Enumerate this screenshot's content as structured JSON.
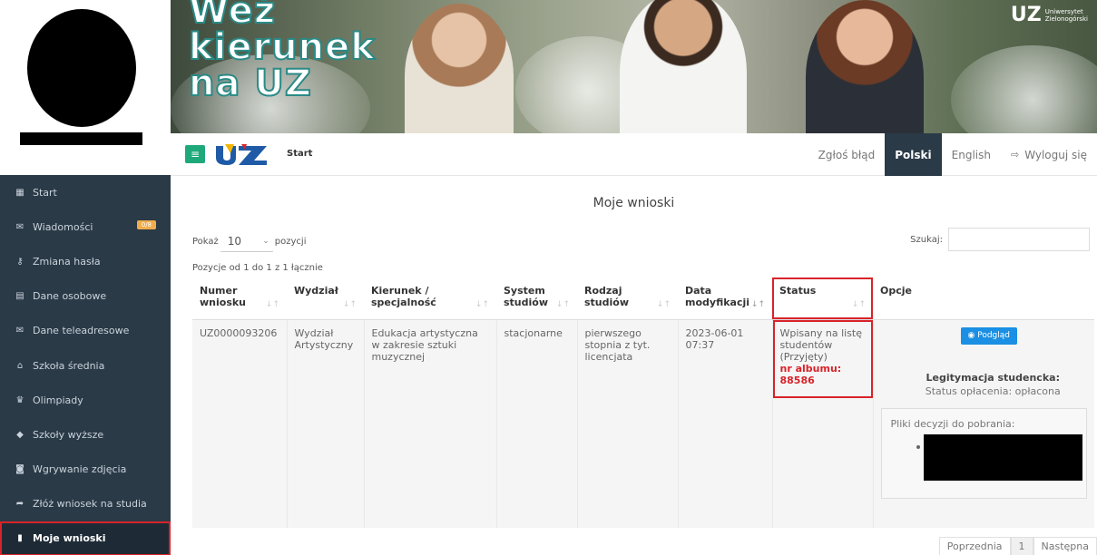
{
  "banner": {
    "title_line1": "Weź",
    "title_line2": "kierunek",
    "title_line3": "na UZ",
    "logo_big": "UZ",
    "logo_small_line1": "Uniwersytet",
    "logo_small_line2": "Zielonogórski"
  },
  "topbar": {
    "breadcrumb": "Start",
    "report_bug": "Zgłoś błąd",
    "lang_pl": "Polski",
    "lang_en": "English",
    "logout": "Wyloguj się"
  },
  "sidebar": {
    "items": [
      {
        "label": "Start",
        "icon": "dashboard-icon"
      },
      {
        "label": "Wiadomości",
        "icon": "envelope-icon",
        "badge": "0/8"
      },
      {
        "label": "Zmiana hasła",
        "icon": "key-icon"
      },
      {
        "label": "Dane osobowe",
        "icon": "id-card-icon"
      },
      {
        "label": "Dane teleadresowe",
        "icon": "envelope-icon"
      },
      {
        "label": "Szkoła średnia",
        "icon": "school-icon"
      },
      {
        "label": "Olimpiady",
        "icon": "trophy-icon"
      },
      {
        "label": "Szkoły wyższe",
        "icon": "graduation-cap-icon"
      },
      {
        "label": "Wgrywanie zdjęcia",
        "icon": "camera-icon"
      },
      {
        "label": "Złóż wniosek na studia",
        "icon": "share-icon"
      },
      {
        "label": "Moje wnioski",
        "icon": "file-icon",
        "active": true
      }
    ]
  },
  "main": {
    "title": "Moje wnioski",
    "show_label": "Pokaż",
    "show_value": "10",
    "show_suffix": "pozycji",
    "search_label": "Szukaj:",
    "search_value": "",
    "info": "Pozycje od 1 do 1 z 1 łącznie",
    "columns": [
      {
        "line1": "Numer",
        "line2": "wniosku"
      },
      {
        "line1": "Wydział",
        "line2": ""
      },
      {
        "line1": "Kierunek /",
        "line2": "specjalność"
      },
      {
        "line1": "System",
        "line2": "studiów"
      },
      {
        "line1": "Rodzaj",
        "line2": "studiów"
      },
      {
        "line1": "Data",
        "line2": "modyfikacji"
      },
      {
        "line1": "Status",
        "line2": ""
      },
      {
        "line1": "Opcje",
        "line2": ""
      }
    ],
    "row": {
      "numer": "UZ0000093206",
      "wydzial": "Wydział Artystyczny",
      "kierunek": "Edukacja artystyczna w zakresie sztuki muzycznej",
      "system": "stacjonarne",
      "rodzaj": "pierwszego stopnia z tyt. licencjata",
      "data": "2023-06-01 07:37",
      "status": "Wpisany na listę studentów (Przyjęty)",
      "album": "nr albumu: 88586",
      "podglad": "Podgląd",
      "leg_title": "Legitymacja studencka:",
      "leg_status": "Status opłacenia: opłacona",
      "files_label": "Pliki decyzji do pobrania:"
    },
    "pagination": {
      "prev": "Poprzednia",
      "page": "1",
      "next": "Następna"
    }
  }
}
